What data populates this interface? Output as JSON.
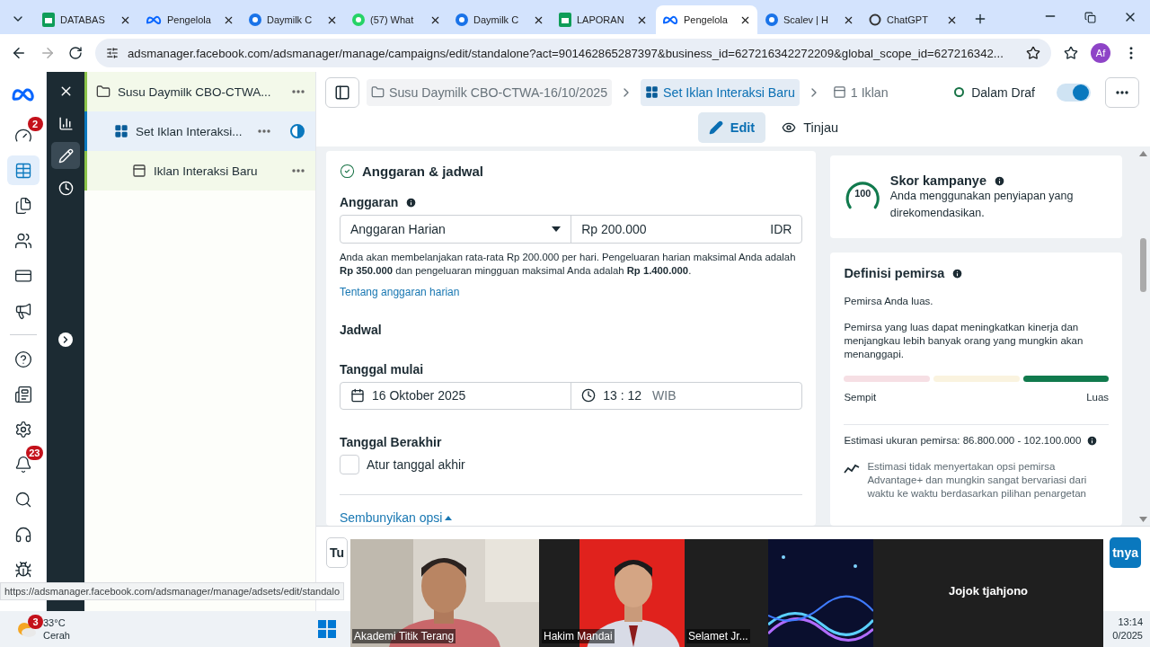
{
  "browser": {
    "tabs": [
      {
        "label": "DATABAS",
        "kind": "sheets",
        "selected": false
      },
      {
        "label": "Pengelola",
        "kind": "meta",
        "selected": false
      },
      {
        "label": "Daymilk C",
        "kind": "daymilk",
        "selected": false
      },
      {
        "label": "(57) What",
        "kind": "whatsapp",
        "selected": false
      },
      {
        "label": "Daymilk C",
        "kind": "daymilk",
        "selected": false
      },
      {
        "label": "LAPORAN",
        "kind": "sheets",
        "selected": false
      },
      {
        "label": "Pengelola",
        "kind": "meta",
        "selected": true
      },
      {
        "label": "Scalev | H",
        "kind": "daymilk",
        "selected": false
      },
      {
        "label": "ChatGPT",
        "kind": "chatgpt",
        "selected": false
      }
    ],
    "address": "adsmanager.facebook.com/adsmanager/manage/campaigns/edit/standalone?act=901462865287397&business_id=627216342272209&global_scope_id=627216342...",
    "profile": "Af"
  },
  "rail": [
    {
      "kind": "dashboard",
      "selected": false,
      "badge": "2"
    },
    {
      "kind": "table",
      "selected": true
    },
    {
      "kind": "documents",
      "selected": false
    },
    {
      "kind": "audience",
      "selected": false
    },
    {
      "kind": "billing",
      "selected": false
    },
    {
      "kind": "ads",
      "selected": false
    },
    {
      "kind": "help",
      "selected": false
    },
    {
      "kind": "news",
      "selected": false
    },
    {
      "kind": "settings",
      "selected": false
    },
    {
      "kind": "notifications",
      "selected": false,
      "badge": "23"
    },
    {
      "kind": "search",
      "selected": false
    },
    {
      "kind": "support",
      "selected": false
    },
    {
      "kind": "bug",
      "selected": false
    }
  ],
  "nav": [
    {
      "kind": "close",
      "selected": false
    },
    {
      "kind": "chart",
      "selected": false
    },
    {
      "kind": "edit",
      "selected": true
    },
    {
      "kind": "history",
      "selected": false
    }
  ],
  "tree": [
    {
      "label": "Susu Daymilk CBO-CTWA...",
      "kind": "campaign",
      "selected": false,
      "children": [
        {
          "label": "Set Iklan Interaksi...",
          "kind": "adset",
          "selected": true,
          "children": [
            {
              "label": "Iklan Interaksi Baru",
              "kind": "ad",
              "selected": false
            }
          ]
        }
      ]
    }
  ],
  "header": {
    "breadcrumbs": [
      {
        "label": "Susu Daymilk CBO-CTWA-16/10/2025",
        "kind": "campaign",
        "selected": false
      },
      {
        "label": "Set Iklan Interaksi Baru",
        "kind": "adset",
        "selected": true
      },
      {
        "label": "1 Iklan",
        "kind": "ad",
        "selected": false
      }
    ],
    "status": "Dalam Draf",
    "toggle": {
      "on": true
    },
    "view_tabs": [
      {
        "label": "Edit",
        "kind": "edit",
        "selected": true
      },
      {
        "label": "Tinjau",
        "kind": "review",
        "selected": false
      }
    ]
  },
  "budget": {
    "title": "Anggaran & jadwal",
    "label": "Anggaran",
    "type": "Anggaran Harian",
    "amount": "Rp 200.000",
    "currency": "IDR",
    "description": "Anda akan membelanjakan rata-rata Rp 200.000 per hari. Pengeluaran harian maksimal Anda adalah **Rp 350.000** dan pengeluaran mingguan maksimal Anda adalah **Rp 1.400.000**.",
    "link": "Tentang anggaran harian",
    "schedule": "Jadwal",
    "start_label": "Tanggal mulai",
    "start_date": "16 Oktober 2025",
    "start_time": "13 : 12",
    "timezone": "WIB",
    "end_label": "Tanggal Berakhir",
    "end_checkbox": {
      "label": "Atur tanggal akhir",
      "checked": false
    },
    "toggle_link": "Sembunyikan opsi"
  },
  "score": {
    "value": "100",
    "title": "Skor kampanye",
    "text": "Anda menggunakan penyiapan yang direkomendasikan."
  },
  "audience": {
    "title": "Definisi pemirsa",
    "summary": "Pemirsa Anda luas.",
    "text": "Pemirsa yang luas dapat meningkatkan kinerja dan menjangkau lebih banyak orang yang mungkin akan menanggapi.",
    "segments": [
      {
        "active": false
      },
      {
        "active": false
      },
      {
        "active": true
      }
    ],
    "min_label": "Sempit",
    "max_label": "Luas",
    "estimate": "Estimasi ukuran pemirsa: 86.800.000 - 102.100.000",
    "note": "Estimasi tidak menyertakan opsi pemirsa Advantage+ dan mungkin sangat bervariasi dari waktu ke waktu berdasarkan pilihan penargetan"
  },
  "footer": {
    "left_button": "Tu",
    "right_button": "tnya"
  },
  "status_url": "https://adsmanager.facebook.com/adsmanager/manage/adsets/edit/standalo",
  "taskbar": {
    "weather_badge": "3",
    "temperature": "33°C",
    "weather": "Cerah",
    "time": "13:14",
    "date": "0/2025"
  },
  "video": [
    {
      "name": "Akademi Titik Terang",
      "kind": "camera"
    },
    {
      "name": "Hakim Mandai",
      "kind": "camera"
    },
    {
      "name": "Selamet Jr...",
      "kind": "camera"
    },
    {
      "name": "Jojok tjahjono",
      "kind": "no_video"
    }
  ]
}
